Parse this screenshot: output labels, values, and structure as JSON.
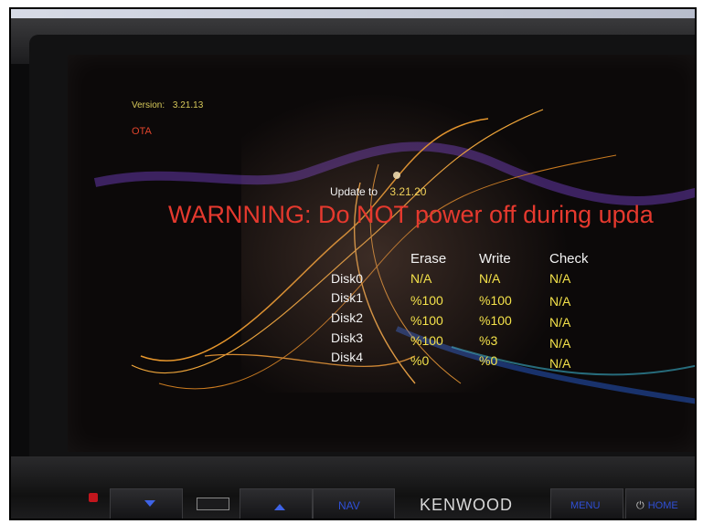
{
  "screen": {
    "version_label": "Version:",
    "version_value": "3.21.13",
    "ota_label": "OTA",
    "update_label": "Update to",
    "update_version": "3.21.20",
    "warning_text": "WARNNING: Do NOT power off during upda"
  },
  "table": {
    "headers": [
      "Erase",
      "Write",
      "Check"
    ],
    "rows": [
      {
        "disk": "Disk0",
        "erase": "N/A",
        "write": "N/A",
        "check": "N/A"
      },
      {
        "disk": "Disk1",
        "erase": "%100",
        "write": "%100",
        "check": "N/A"
      },
      {
        "disk": "Disk2",
        "erase": "%100",
        "write": "%100",
        "check": "N/A"
      },
      {
        "disk": "Disk3",
        "erase": "%100",
        "write": "%3",
        "check": "N/A"
      },
      {
        "disk": "Disk4",
        "erase": "%0",
        "write": "%0",
        "check": "N/A"
      }
    ]
  },
  "panel": {
    "brand": "KENWOOD",
    "nav": "NAV",
    "menu": "MENU",
    "home": "HOME",
    "power_glyph": "⏻"
  },
  "colors": {
    "warning": "#e5392e",
    "value": "#f3e14a",
    "panel_label": "#2f4fd6"
  },
  "icons": {
    "down": "arrow-down-icon",
    "up": "arrow-up-icon",
    "power": "power-icon"
  }
}
